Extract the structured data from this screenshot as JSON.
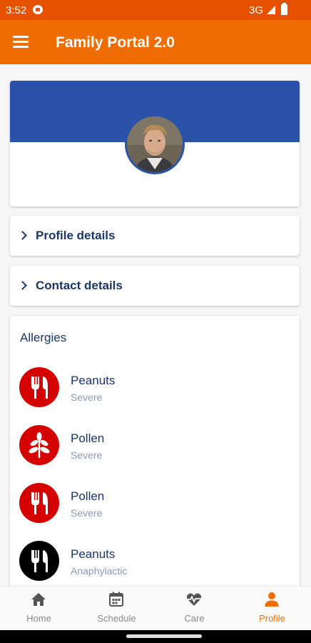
{
  "status_bar": {
    "time": "3:52",
    "network": "3G"
  },
  "app_bar": {
    "title": "Family Portal 2.0"
  },
  "sections": {
    "profile_details": "Profile details",
    "contact_details": "Contact details"
  },
  "allergies": {
    "title": "Allergies",
    "items": [
      {
        "name": "Peanuts",
        "severity": "Severe",
        "icon": "cutlery-icon",
        "color": "#d50000"
      },
      {
        "name": "Pollen",
        "severity": "Severe",
        "icon": "leaf-icon",
        "color": "#d50000"
      },
      {
        "name": "Pollen",
        "severity": "Severe",
        "icon": "cutlery-icon",
        "color": "#d50000"
      },
      {
        "name": "Peanuts",
        "severity": "Anaphylactic",
        "icon": "cutlery-icon",
        "color": "#000000"
      }
    ]
  },
  "bottom_nav": {
    "items": [
      {
        "label": "Home",
        "icon": "home-icon"
      },
      {
        "label": "Schedule",
        "icon": "calendar-icon"
      },
      {
        "label": "Care",
        "icon": "heart-pulse-icon"
      },
      {
        "label": "Profile",
        "icon": "person-icon",
        "active": true
      }
    ]
  },
  "colors": {
    "accent": "#ef6c00",
    "banner": "#2a52a8",
    "text_primary": "#1a3668"
  }
}
